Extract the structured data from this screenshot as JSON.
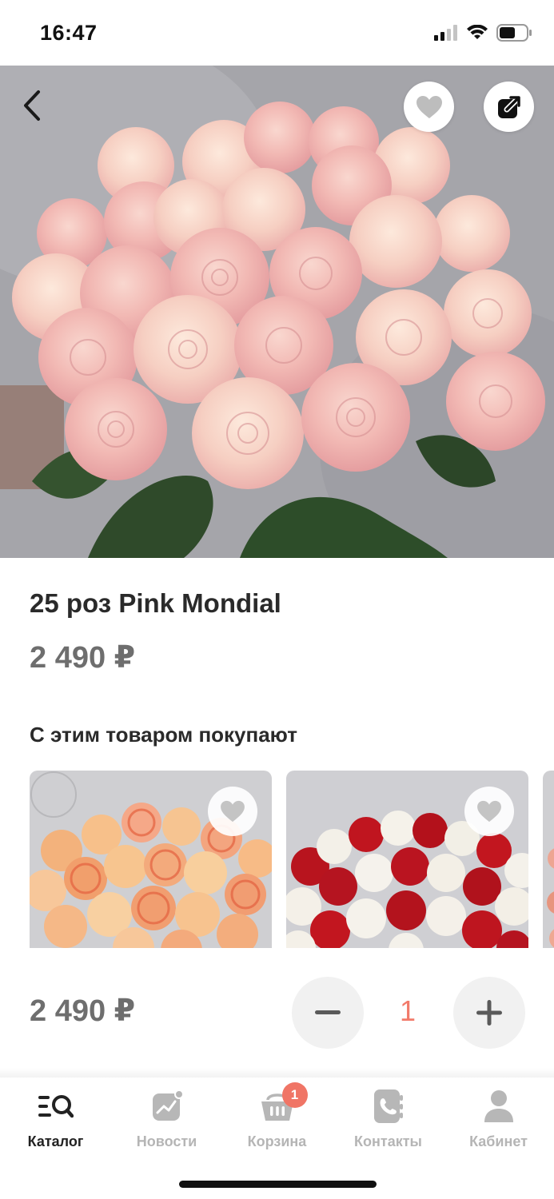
{
  "status_bar": {
    "time": "16:47",
    "icons": [
      "cellular-signal-icon",
      "wifi-icon",
      "battery-icon"
    ]
  },
  "hero": {
    "icons": {
      "back": "chevron-left-icon",
      "favorite": "heart-icon",
      "share": "share-icon"
    }
  },
  "product": {
    "title": "25 роз Pink Mondial",
    "price": "2 490 ₽"
  },
  "related": {
    "title": "С этим товаром покупают",
    "items": [
      {
        "image": "peach-roses-bouquet",
        "favorite_icon": "heart-icon"
      },
      {
        "image": "red-white-roses-bouquet",
        "favorite_icon": "heart-icon"
      },
      {
        "image": "partial-bouquet"
      }
    ]
  },
  "purchase": {
    "price": "2 490 ₽",
    "quantity": "1",
    "minus_icon": "minus-icon",
    "plus_icon": "plus-icon"
  },
  "tab_bar": {
    "tabs": [
      {
        "label": "Каталог",
        "icon": "catalog-search-icon",
        "active": true
      },
      {
        "label": "Новости",
        "icon": "news-chart-icon",
        "active": false
      },
      {
        "label": "Корзина",
        "icon": "basket-icon",
        "active": false,
        "badge": "1"
      },
      {
        "label": "Контакты",
        "icon": "phone-book-icon",
        "active": false
      },
      {
        "label": "Кабинет",
        "icon": "user-icon",
        "active": false
      }
    ]
  },
  "colors": {
    "accent": "#f07566",
    "price_gray": "#6e6e6e",
    "inactive_tab": "#b5b5b5",
    "qty_button_bg": "#f1f1f1"
  }
}
